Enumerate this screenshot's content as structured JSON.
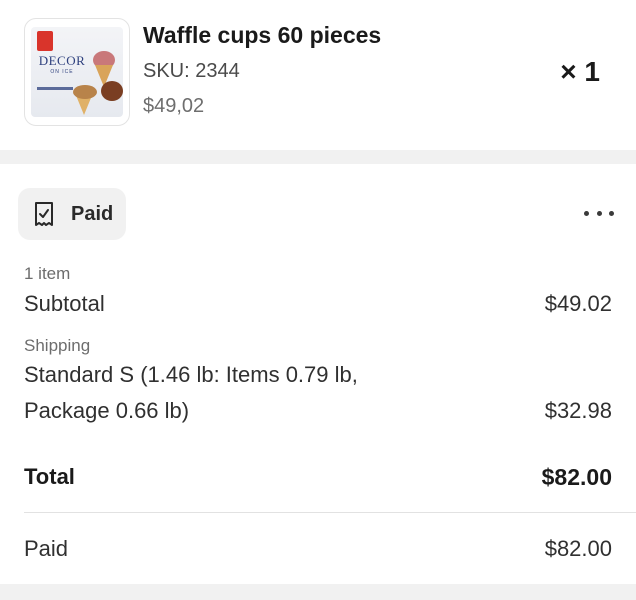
{
  "product": {
    "title": "Waffle cups 60 pieces",
    "sku": "SKU: 2344",
    "price": "$49,02",
    "quantity": "× 1",
    "thumbnail": {
      "brand": "DECOR",
      "brand_sub": "ON ICE"
    }
  },
  "payment": {
    "status_label": "Paid",
    "status_icon": "receipt-check-icon",
    "more_icon": "more-horizontal-icon"
  },
  "summary": {
    "item_count": "1 item",
    "subtotal_label": "Subtotal",
    "subtotal_value": "$49.02",
    "shipping_heading": "Shipping",
    "shipping_line1": "Standard S (1.46 lb: Items 0.79 lb,",
    "shipping_line2": "Package 0.66 lb)",
    "shipping_value": "$32.98",
    "total_label": "Total",
    "total_value": "$82.00",
    "paid_label": "Paid",
    "paid_value": "$82.00"
  }
}
